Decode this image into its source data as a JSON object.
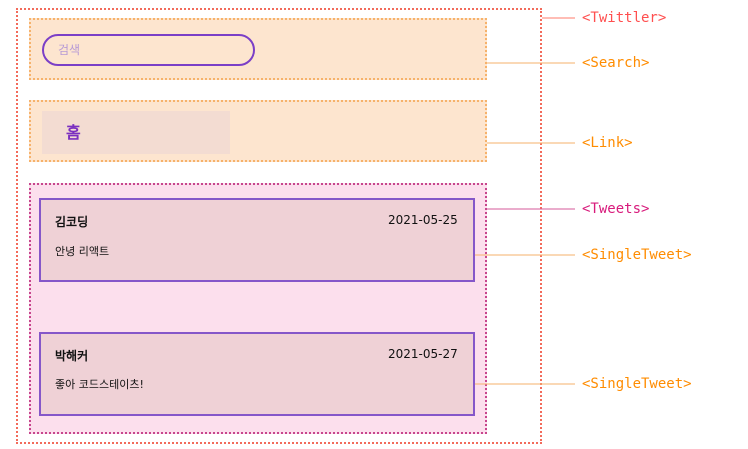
{
  "search": {
    "placeholder": "검색"
  },
  "link": {
    "home_label": "홈"
  },
  "tweets": [
    {
      "author": "김코딩",
      "date": "2021-05-25",
      "content": "안녕 리액트"
    },
    {
      "author": "박해커",
      "date": "2021-05-27",
      "content": "좋아 코드스테이츠!"
    }
  ],
  "labels": {
    "twittler": "<Twittler>",
    "search": "<Search>",
    "link": "<Link>",
    "tweets": "<Tweets>",
    "single_tweet_1": "<SingleTweet>",
    "single_tweet_2": "<SingleTweet>"
  },
  "colors": {
    "twittler": "#f26b5b",
    "search_link_border": "#f6b26b",
    "tweets_border": "#c7458d",
    "tweet_border": "#8557c9",
    "label_orange": "#ff8c00",
    "label_red": "#ff4f4f",
    "label_magenta": "#d81b7c"
  }
}
